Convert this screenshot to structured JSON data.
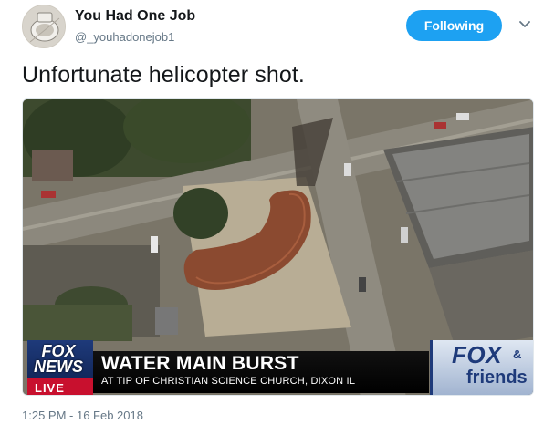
{
  "author": {
    "name": "You Had One Job",
    "handle": "@_youhadonejob1"
  },
  "follow_button": {
    "label": "Following",
    "color": "#1da1f2"
  },
  "caret_icon": "chevron-down-icon",
  "tweet": {
    "text": "Unfortunate helicopter shot.",
    "timestamp": "1:25 PM - 16 Feb 2018"
  },
  "media": {
    "network_logo": [
      "FOX",
      "NEWS"
    ],
    "live_label": "LIVE",
    "headline": "WATER MAIN BURST",
    "subheadline": "AT TIP OF CHRISTIAN SCIENCE CHURCH, DIXON IL",
    "show_logo": {
      "fox": "FOX",
      "amp": "&",
      "friends": "friends"
    }
  },
  "colors": {
    "text_primary": "#14171a",
    "text_secondary": "#657786",
    "accent": "#1da1f2",
    "live_red": "#c8102e",
    "fox_blue": "#1e3a7a"
  }
}
